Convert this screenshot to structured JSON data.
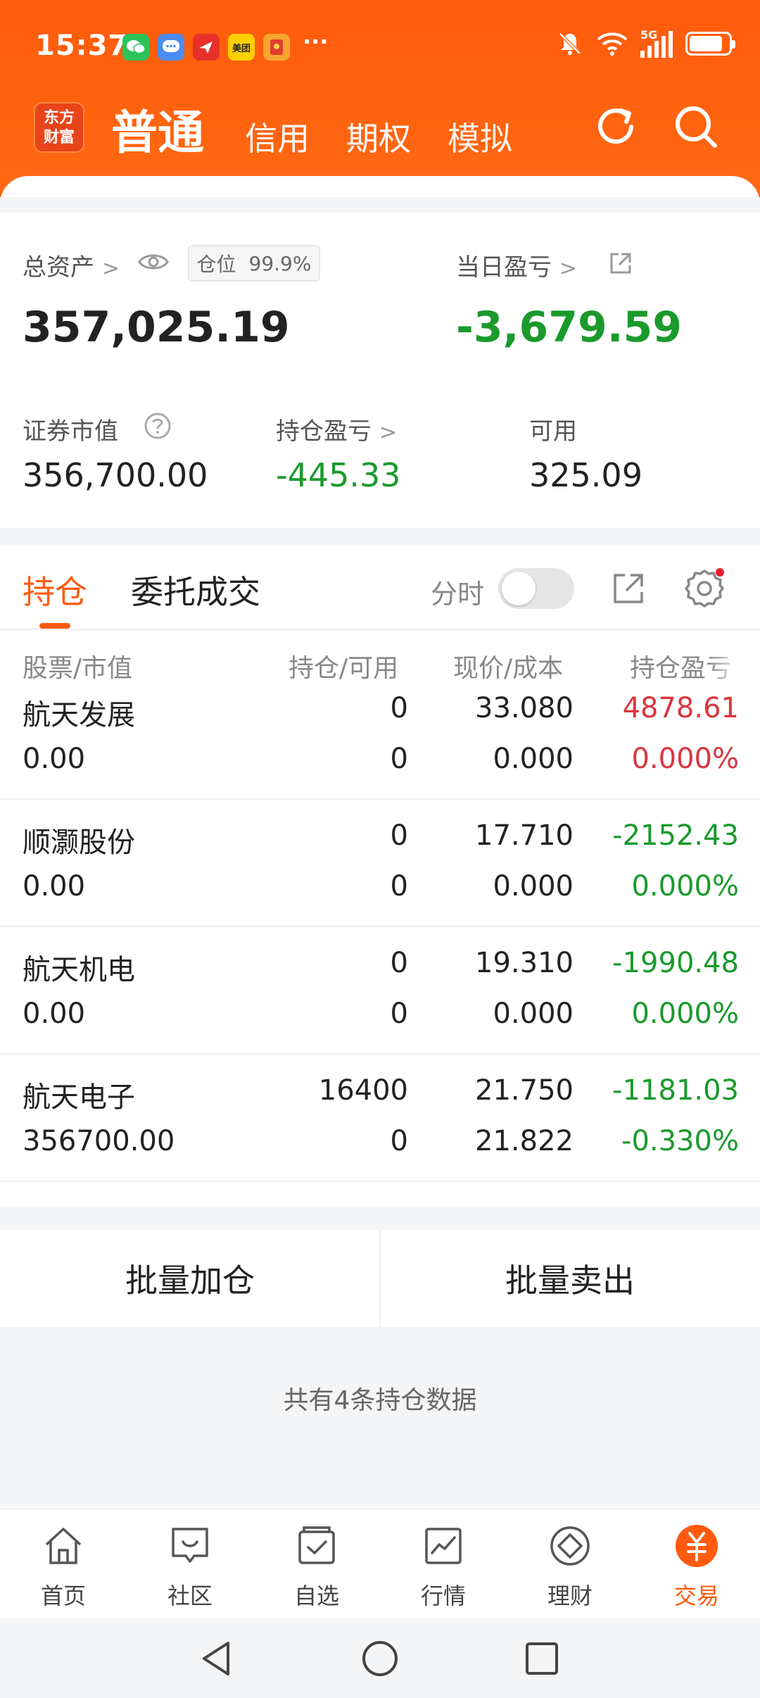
{
  "status_bar": {
    "time": "15:37",
    "more": "···",
    "meituan": "美团",
    "network": "5G"
  },
  "header": {
    "logo_line1": "东方",
    "logo_line2": "财富",
    "tabs": [
      {
        "label": "普通",
        "active": true
      },
      {
        "label": "信用",
        "active": false
      },
      {
        "label": "期权",
        "active": false
      },
      {
        "label": "模拟",
        "active": false
      }
    ]
  },
  "summary": {
    "total_assets_label": "总资产",
    "total_assets_arrow": ">",
    "position_label": "仓位",
    "position_value": "99.9%",
    "total_assets": "357,025.19",
    "daily_pl_label": "当日盈亏",
    "daily_pl_arrow": ">",
    "daily_pl": "-3,679.59",
    "market_value_label": "证券市值",
    "market_value": "356,700.00",
    "position_pl_label": "持仓盈亏",
    "position_pl_arrow": ">",
    "position_pl": "-445.33",
    "available_label": "可用",
    "available": "325.09"
  },
  "holdings": {
    "tab_holdings": "持仓",
    "tab_orders": "委托成交",
    "toggle_label": "分时",
    "columns": [
      "股票/市值",
      "持仓/可用",
      "现价/成本",
      "持仓盈亏"
    ],
    "rows": [
      {
        "name": "航天发展",
        "market_value": "0.00",
        "position": "0",
        "available": "0",
        "price": "33.080",
        "cost": "0.000",
        "pl": "4878.61",
        "pl_pct": "0.000%",
        "color": "#d9363e"
      },
      {
        "name": "顺灏股份",
        "market_value": "0.00",
        "position": "0",
        "available": "0",
        "price": "17.710",
        "cost": "0.000",
        "pl": "-2152.43",
        "pl_pct": "0.000%",
        "color": "#1a9a2c"
      },
      {
        "name": "航天机电",
        "market_value": "0.00",
        "position": "0",
        "available": "0",
        "price": "19.310",
        "cost": "0.000",
        "pl": "-1990.48",
        "pl_pct": "0.000%",
        "color": "#1a9a2c"
      },
      {
        "name": "航天电子",
        "market_value": "356700.00",
        "position": "16400",
        "available": "0",
        "price": "21.750",
        "cost": "21.822",
        "pl": "-1181.03",
        "pl_pct": "-0.330%",
        "color": "#1a9a2c"
      }
    ]
  },
  "batch": {
    "add": "批量加仓",
    "sell": "批量卖出"
  },
  "footer_summary": "共有4条持仓数据",
  "bottom_nav": [
    {
      "label": "首页",
      "icon": "home-icon"
    },
    {
      "label": "社区",
      "icon": "community-icon"
    },
    {
      "label": "自选",
      "icon": "watchlist-icon"
    },
    {
      "label": "行情",
      "icon": "market-icon"
    },
    {
      "label": "理财",
      "icon": "wealth-icon"
    },
    {
      "label": "交易",
      "icon": "trade-icon",
      "active": true
    }
  ],
  "colors": {
    "brand": "#ff5a10",
    "up": "#d9363e",
    "down": "#1a9a2c"
  }
}
